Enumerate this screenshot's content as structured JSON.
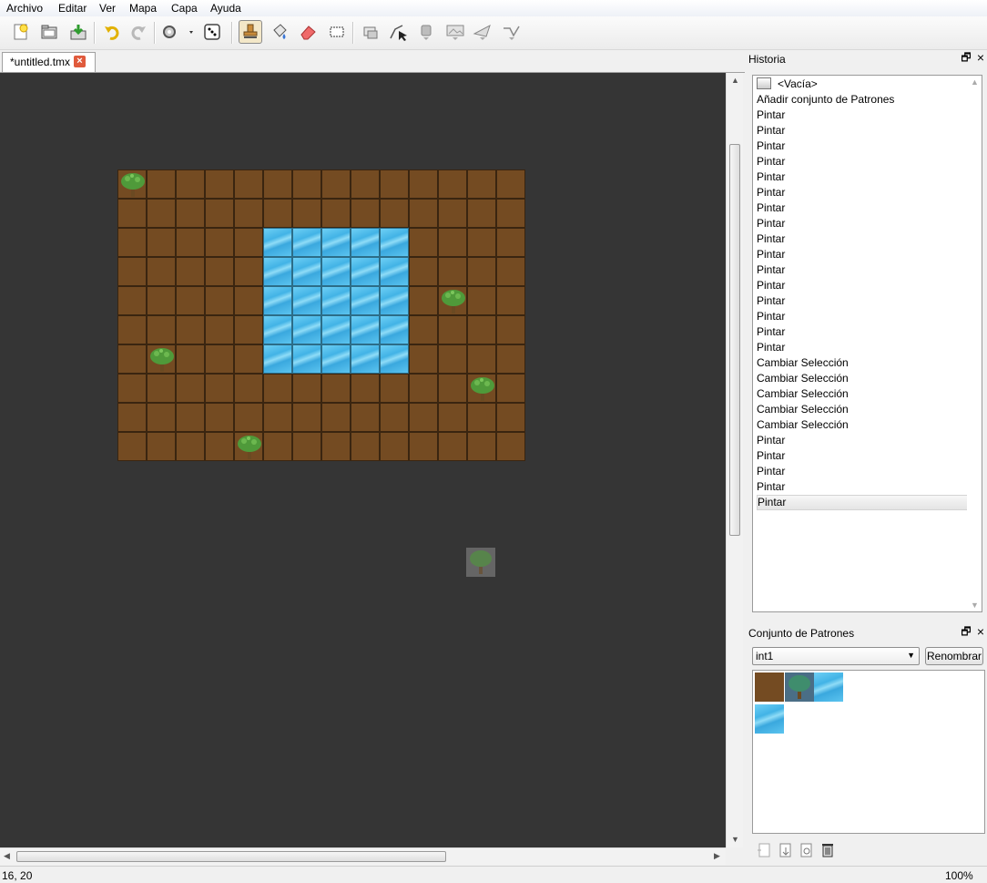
{
  "menu": {
    "items": [
      "Archivo",
      "Editar",
      "Ver",
      "Mapa",
      "Capa",
      "Ayuda"
    ]
  },
  "toolbar": {
    "buttons": [
      {
        "name": "new-file-icon"
      },
      {
        "name": "open-folder-icon"
      },
      {
        "name": "save-icon"
      },
      {
        "name": "undo-icon"
      },
      {
        "name": "redo-icon"
      },
      {
        "name": "commands-gear-icon"
      },
      {
        "name": "random-dice-icon"
      },
      {
        "name": "stamp-brush-icon",
        "active": true
      },
      {
        "name": "bucket-fill-icon"
      },
      {
        "name": "eraser-icon"
      },
      {
        "name": "rect-select-icon"
      },
      {
        "name": "select-objects-icon"
      },
      {
        "name": "edit-polygons-icon"
      },
      {
        "name": "insert-rectangle-icon"
      },
      {
        "name": "insert-image-icon"
      },
      {
        "name": "insert-polygon-icon"
      },
      {
        "name": "insert-polyline-icon"
      }
    ]
  },
  "tabs": [
    {
      "label": "*untitled.tmx",
      "close": "×"
    }
  ],
  "map": {
    "cols": 14,
    "rows": 10,
    "colors": {
      "dirt": "#744b22",
      "grid": "#3a2510",
      "water": "#4fbcea",
      "canvas": "#353535"
    },
    "water": {
      "col": 5,
      "row": 2,
      "cols": 5,
      "rows": 5
    },
    "trees": [
      [
        0,
        0
      ],
      [
        11,
        4
      ],
      [
        1,
        6
      ],
      [
        12,
        7
      ],
      [
        4,
        9
      ]
    ]
  },
  "cursor_preview": {
    "name": "tree-tile-cursor"
  },
  "history": {
    "title": "Historia",
    "items": [
      "<Vacía>",
      "Añadir conjunto de Patrones",
      "Pintar",
      "Pintar",
      "Pintar",
      "Pintar",
      "Pintar",
      "Pintar",
      "Pintar",
      "Pintar",
      "Pintar",
      "Pintar",
      "Pintar",
      "Pintar",
      "Pintar",
      "Pintar",
      "Pintar",
      "Pintar",
      "Cambiar Selección",
      "Cambiar Selección",
      "Cambiar Selección",
      "Cambiar Selección",
      "Cambiar Selección",
      "Pintar",
      "Pintar",
      "Pintar",
      "Pintar",
      "Pintar"
    ],
    "selected_index": 27
  },
  "tileset": {
    "title": "Conjunto de Patrones",
    "selected": "int1",
    "rename_label": "Renombrar",
    "bottom_tools": [
      "new-tileset-icon",
      "import-tileset-icon",
      "properties-icon",
      "delete-tileset-icon"
    ]
  },
  "status": {
    "position": "16, 20",
    "zoom": "100%"
  },
  "dock": {
    "float": "🗗",
    "close": "×"
  }
}
